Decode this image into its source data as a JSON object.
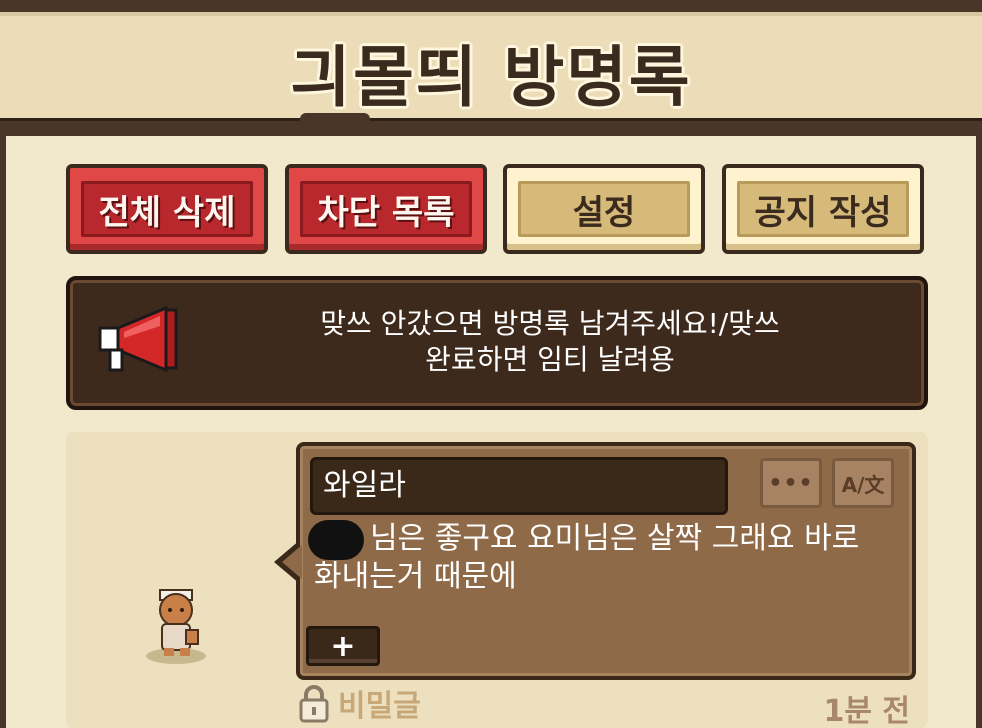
{
  "header": {
    "title": "긔몰띄 방명록"
  },
  "toolbar": {
    "delete_all": "전체 삭제",
    "block_list": "차단 목록",
    "settings": "설정",
    "write_notice": "공지 작성"
  },
  "notice": {
    "line1": "맞쓰 안갔으면 방명록 남겨주세요!/맞쓰",
    "line2": "완료하면 임티 날려용",
    "icon": "megaphone-icon"
  },
  "entry": {
    "author": "와일라",
    "more_label": "•••",
    "translate_label": "A/文",
    "message_line1": "님은 좋구요 요미님은 살짝 그래요 바로",
    "message_line2": "화내는거 때문에",
    "add_label": "+",
    "secret_label": "비밀글",
    "time": "1분 전"
  },
  "colors": {
    "background": "#f1e7c9",
    "frame": "#4a3628",
    "red_button": "#b8282c",
    "tan_button": "#d6ba7a",
    "bubble": "#8f6a48"
  }
}
